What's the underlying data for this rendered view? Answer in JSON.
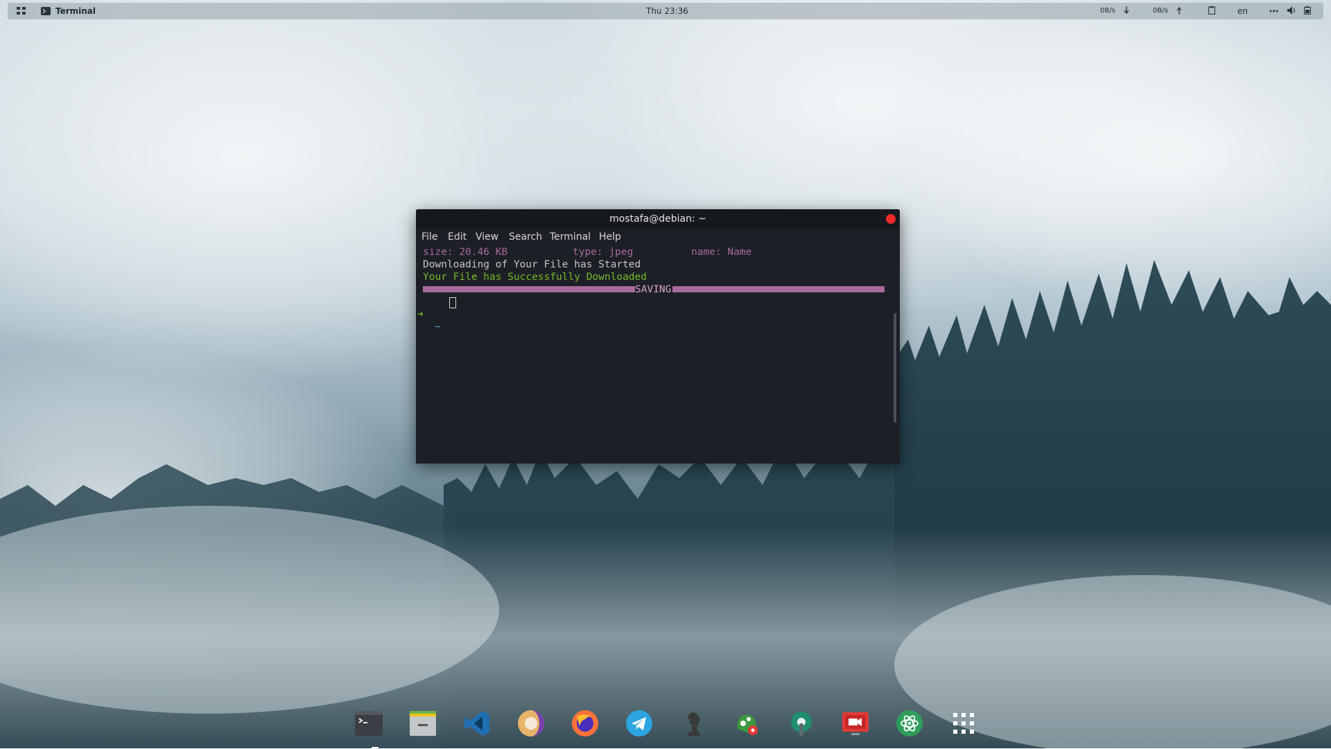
{
  "topbar": {
    "active_app": "Terminal",
    "clock": "Thu 23:36",
    "net_down": "0B/s",
    "net_up": "0B/s",
    "language": "en",
    "icons": [
      "apps-grid-icon",
      "terminal-app-icon",
      "download-arrow-icon",
      "upload-arrow-icon",
      "clipboard-icon",
      "more-dots-icon",
      "volume-icon",
      "battery-icon"
    ]
  },
  "terminal": {
    "title": "mostafa@debian: ~",
    "menu": [
      "File",
      "Edit",
      "View",
      "Search",
      "Terminal",
      "Help"
    ],
    "output": {
      "size": "size: 20.46 KB",
      "type": "type: jpeg",
      "name": "name: Name",
      "started": "Downloading of Your File has Started",
      "done": "Your File has Successfully Downloaded",
      "saving_label": "SAVING",
      "progress": 1.0,
      "prompt_arrow": "➜",
      "prompt_dir": "~"
    },
    "colors": {
      "accent": "#a76a9a",
      "success": "#76b82a",
      "close": "#ef2929"
    }
  },
  "dock": {
    "apps": [
      "terminal-icon",
      "files-icon",
      "vscode-icon",
      "eclipse-icon",
      "firefox-icon",
      "telegram-icon",
      "chess-icon",
      "gnome-settings-icon",
      "tweaks-icon",
      "screen-recorder-icon",
      "atom-icon",
      "show-apps-icon"
    ]
  }
}
